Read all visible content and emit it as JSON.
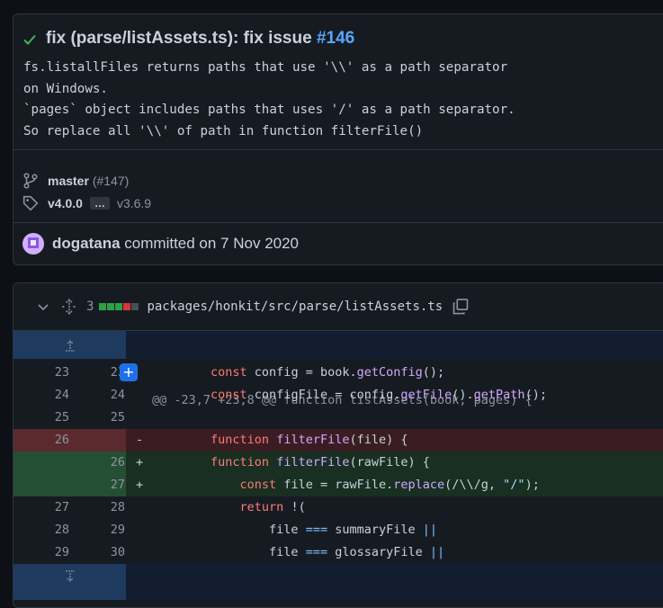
{
  "commit": {
    "title_prefix": "fix (parse/listAssets.ts): fix issue ",
    "issue_link": "#146",
    "description": "fs.listallFiles returns paths that use '\\\\' as a path separator\non Windows.\n`pages` object includes paths that uses '/' as a path separator.\nSo replace all '\\\\' of path in function filterFile()",
    "branch": "master",
    "pr": "(#147)",
    "tag_latest": "v4.0.0",
    "tag_ellipsis": "…",
    "tag_oldest": "v3.6.9",
    "author": "dogatana",
    "committed_text": "committed on 7 Nov 2020"
  },
  "file": {
    "change_count": "3",
    "path": "packages/honkit/src/parse/listAssets.ts"
  },
  "diff": {
    "hunk_header": "@@ -23,7 +23,8 @@ function listAssets(book, pages) {",
    "lines": [
      {
        "old": "23",
        "new": "23",
        "marker": "",
        "type": "ctx"
      },
      {
        "old": "24",
        "new": "24",
        "marker": "",
        "type": "ctx"
      },
      {
        "old": "25",
        "new": "25",
        "marker": "",
        "type": "ctx"
      },
      {
        "old": "26",
        "new": "",
        "marker": "-",
        "type": "del"
      },
      {
        "old": "",
        "new": "26",
        "marker": "+",
        "type": "add"
      },
      {
        "old": "",
        "new": "27",
        "marker": "+",
        "type": "add"
      },
      {
        "old": "27",
        "new": "28",
        "marker": "",
        "type": "ctx"
      },
      {
        "old": "28",
        "new": "29",
        "marker": "",
        "type": "ctx"
      },
      {
        "old": "29",
        "new": "30",
        "marker": "",
        "type": "ctx"
      }
    ],
    "code_tokens": [
      [
        "const",
        " config = book.",
        "getConfig",
        "();"
      ],
      [
        "const",
        " configFile = config.",
        "getFile",
        "().",
        "getPath",
        "();"
      ],
      [],
      [
        "function",
        " ",
        "filterFile",
        "(file) {"
      ],
      [
        "function",
        " ",
        "filterFile",
        "(rawFile) {"
      ],
      [
        "const",
        " file = rawFile.",
        "replace",
        "(/\\\\/g, ",
        "\"/\"",
        ");"
      ],
      [
        "return",
        " !("
      ],
      [
        "file ",
        "===",
        " summaryFile ",
        "||"
      ],
      [
        "file ",
        "===",
        " glossaryFile ",
        "||"
      ]
    ]
  }
}
